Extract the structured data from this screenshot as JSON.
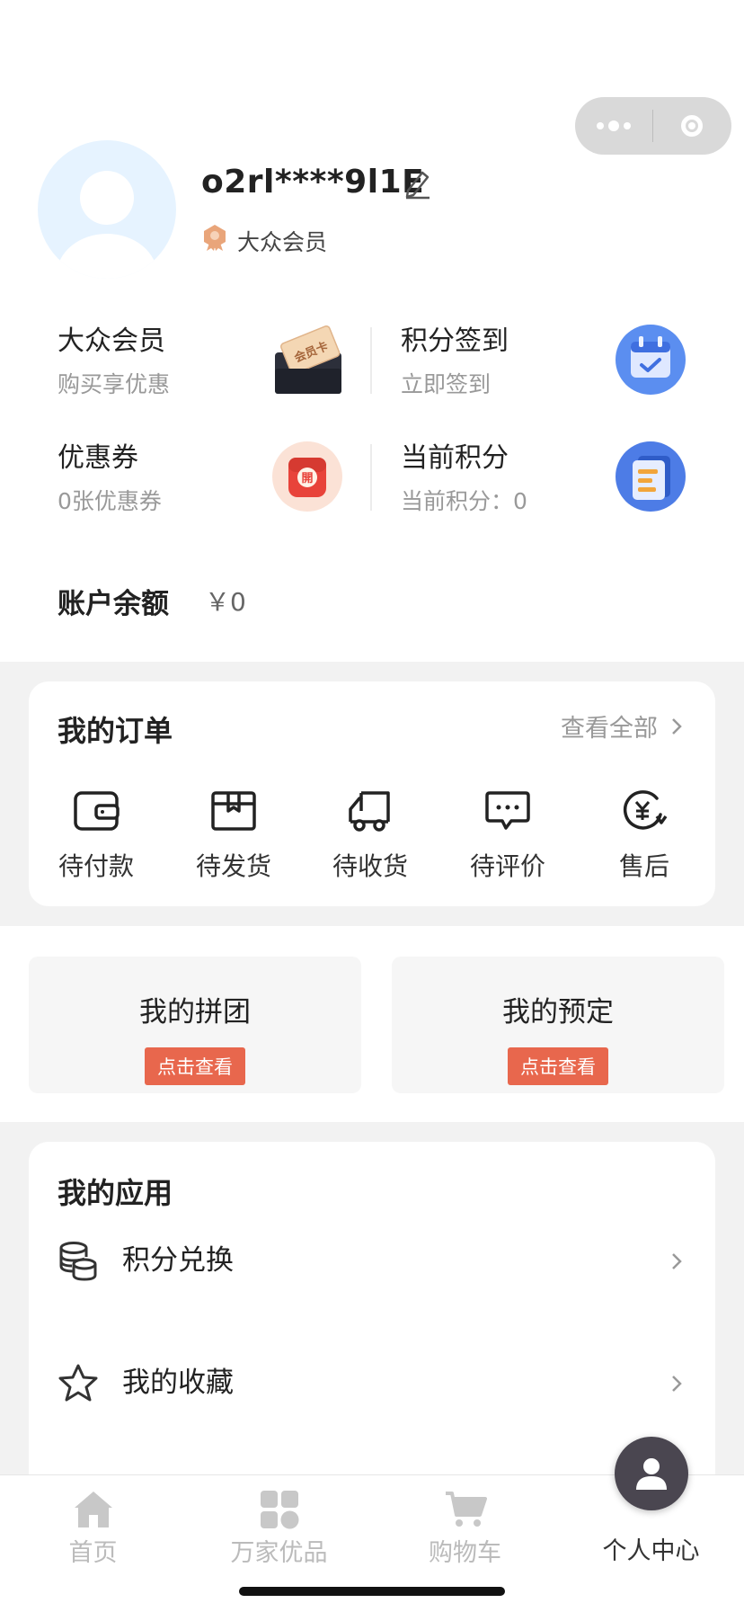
{
  "profile": {
    "username": "o2rl****9l1E",
    "member_level": "大众会员"
  },
  "benefits": {
    "membership": {
      "title": "大众会员",
      "subtitle": "购买享优惠",
      "card_text": "会员卡"
    },
    "checkin": {
      "title": "积分签到",
      "subtitle": "立即签到"
    },
    "coupons": {
      "title": "优惠券",
      "subtitle": "0张优惠券",
      "badge_text": "開"
    },
    "points": {
      "title": "当前积分",
      "subtitle": "当前积分：0"
    }
  },
  "balance": {
    "label": "账户余额",
    "value": "￥0"
  },
  "orders": {
    "title": "我的订单",
    "view_all": "查看全部",
    "items": [
      {
        "label": "待付款",
        "icon": "wallet-icon"
      },
      {
        "label": "待发货",
        "icon": "package-icon"
      },
      {
        "label": "待收货",
        "icon": "truck-icon"
      },
      {
        "label": "待评价",
        "icon": "comment-icon"
      },
      {
        "label": "售后",
        "icon": "refund-icon"
      }
    ]
  },
  "features": [
    {
      "title": "我的拼团",
      "button": "点击查看"
    },
    {
      "title": "我的预定",
      "button": "点击查看"
    }
  ],
  "apps": {
    "title": "我的应用",
    "items": [
      {
        "label": "积分兑换",
        "icon": "coins-icon"
      },
      {
        "label": "我的收藏",
        "icon": "star-icon"
      }
    ]
  },
  "tabbar": {
    "items": [
      {
        "label": "首页",
        "icon": "home-icon"
      },
      {
        "label": "万家优品",
        "icon": "grid-icon"
      },
      {
        "label": "购物车",
        "icon": "cart-icon"
      },
      {
        "label": "个人中心",
        "icon": "user-icon",
        "active": true
      }
    ]
  },
  "colors": {
    "accent": "#e8674d",
    "badge": "#e9a57a",
    "tab_inactive": "#bbbbbb",
    "fab": "#4a4650"
  }
}
